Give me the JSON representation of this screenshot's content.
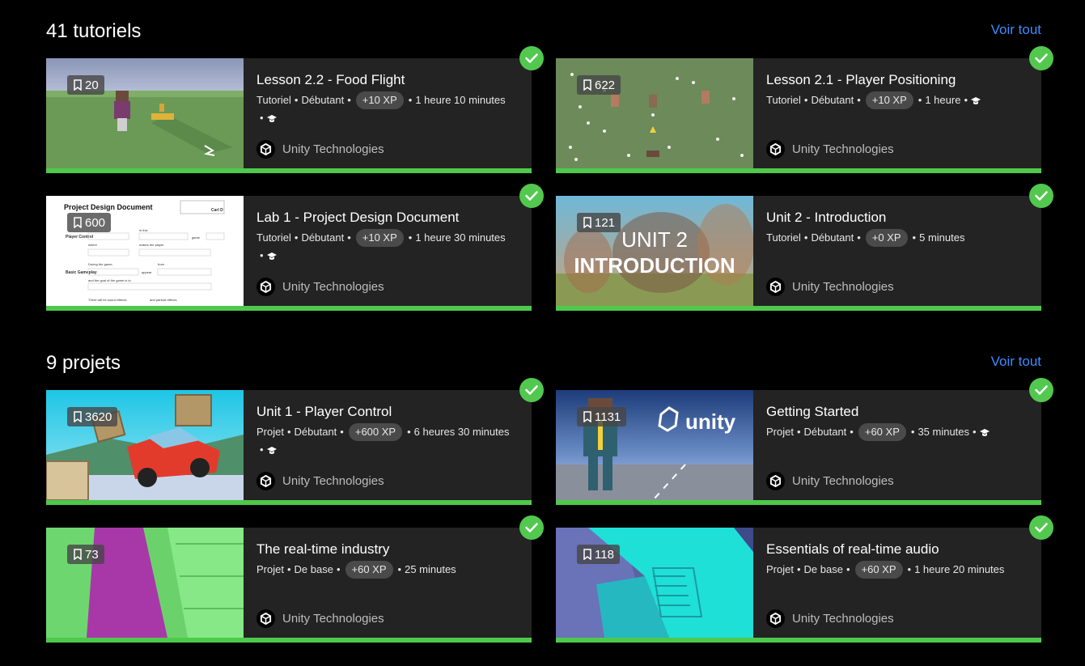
{
  "tutorials": {
    "heading": "41 tutoriels",
    "see_all": "Voir tout",
    "cards": [
      {
        "title": "Lesson 2.2 - Food Flight",
        "type": "Tutoriel",
        "level": "Débutant",
        "xp": "+10 XP",
        "duration": "1 heure 10 minutes",
        "bookmarks": "20",
        "author": "Unity Technologies"
      },
      {
        "title": "Lesson 2.1 - Player Positioning",
        "type": "Tutoriel",
        "level": "Débutant",
        "xp": "+10 XP",
        "duration": "1 heure",
        "bookmarks": "622",
        "author": "Unity Technologies"
      },
      {
        "title": "Lab 1 - Project Design Document",
        "type": "Tutoriel",
        "level": "Débutant",
        "xp": "+10 XP",
        "duration": "1 heure 30 minutes",
        "bookmarks": "600",
        "author": "Unity Technologies",
        "thumb_text": {
          "doc_title": "Project Design Document",
          "name_box": "Carl D",
          "row1": "Player Control",
          "row2": "Basic Gameplay",
          "l1": "in this",
          "l2": "game",
          "l3": "where",
          "l4": "makes the player",
          "l5": "During the game,",
          "l6": "from",
          "l7": "appear",
          "l8": "and the goal of the game is to",
          "l9": "There will be sound effects",
          "l10": "and particle effects"
        }
      },
      {
        "title": "Unit 2 - Introduction",
        "type": "Tutoriel",
        "level": "Débutant",
        "xp": "+0 XP",
        "duration": "5 minutes",
        "bookmarks": "121",
        "author": "Unity Technologies",
        "thumb_text": {
          "line1": "UNIT 2",
          "line2": "INTRODUCTION"
        }
      }
    ]
  },
  "projects": {
    "heading": "9 projets",
    "see_all": "Voir tout",
    "cards": [
      {
        "title": "Unit 1 - Player Control",
        "type": "Projet",
        "level": "Débutant",
        "xp": "+600 XP",
        "duration": "6 heures 30 minutes",
        "bookmarks": "3620",
        "author": "Unity Technologies"
      },
      {
        "title": "Getting Started",
        "type": "Projet",
        "level": "Débutant",
        "xp": "+60 XP",
        "duration": "35 minutes",
        "bookmarks": "1131",
        "author": "Unity Technologies",
        "thumb_text": {
          "logo": "unity"
        }
      },
      {
        "title": "The real-time industry",
        "type": "Projet",
        "level": "De base",
        "xp": "+60 XP",
        "duration": "25 minutes",
        "bookmarks": "73",
        "author": "Unity Technologies"
      },
      {
        "title": "Essentials of real-time audio",
        "type": "Projet",
        "level": "De base",
        "xp": "+60 XP",
        "duration": "1 heure 20 minutes",
        "bookmarks": "118",
        "author": "Unity Technologies"
      }
    ]
  },
  "colors": {
    "accent": "#3d8bff",
    "complete": "#52c84f",
    "card_bg": "#232323",
    "xp_pill": "#4a4a4a"
  },
  "icons": {
    "bookmark": "bookmark-icon",
    "check": "check-icon",
    "cap": "graduation-cap-icon",
    "author_logo": "unity-logo-icon"
  }
}
